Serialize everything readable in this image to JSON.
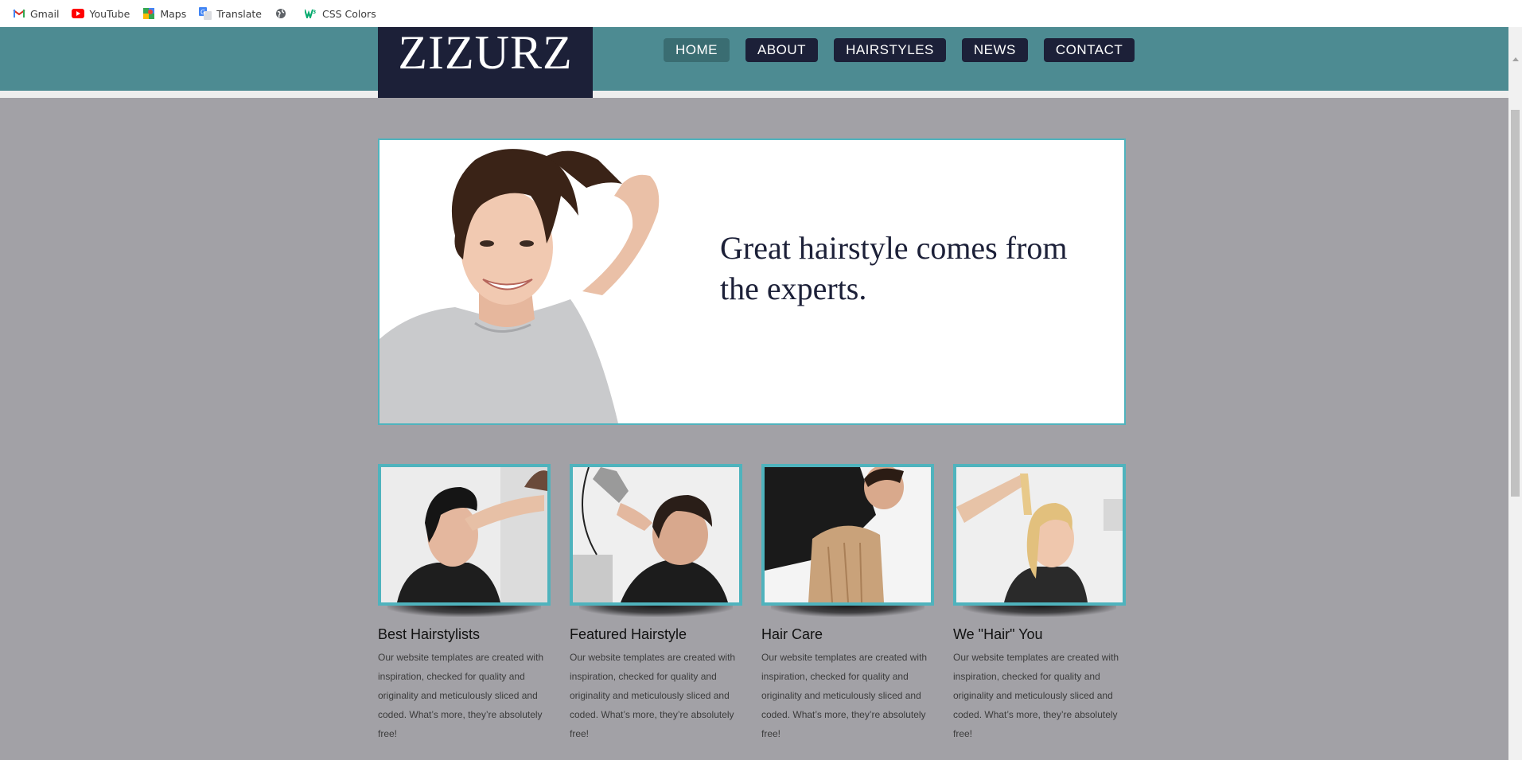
{
  "bookmarks": [
    {
      "label": "Gmail",
      "icon": "gmail-icon"
    },
    {
      "label": "YouTube",
      "icon": "youtube-icon"
    },
    {
      "label": "Maps",
      "icon": "maps-icon"
    },
    {
      "label": "Translate",
      "icon": "translate-icon"
    },
    {
      "label": "",
      "icon": "globe-icon"
    },
    {
      "label": "CSS Colors",
      "icon": "w3schools-icon"
    }
  ],
  "site": {
    "logo": "ZIZURZ",
    "nav": [
      "HOME",
      "ABOUT",
      "HAIRSTYLES",
      "NEWS",
      "CONTACT"
    ],
    "active_nav": "HOME"
  },
  "hero": {
    "tagline": "Great hairstyle comes from the experts."
  },
  "features": [
    {
      "title": "Best Hairstylists",
      "text": "Our website templates are created with inspiration, checked for quality and originality and meticulously sliced and coded. What’s more, they’re absolutely free!"
    },
    {
      "title": "Featured Hairstyle",
      "text": "Our website templates are created with inspiration, checked for quality and originality and meticulously sliced and coded. What’s more, they’re absolutely free!"
    },
    {
      "title": "Hair Care",
      "text": "Our website templates are created with inspiration, checked for quality and originality and meticulously sliced and coded. What’s more, they’re absolutely free!"
    },
    {
      "title": "We \"Hair\" You",
      "text": "Our website templates are created with inspiration, checked for quality and originality and meticulously sliced and coded. What’s more, they’re absolutely free!"
    }
  ],
  "colors": {
    "header": "#4d8b92",
    "navy": "#1c2038",
    "accent": "#4fb3bd",
    "page_bg": "#a2a1a6"
  }
}
